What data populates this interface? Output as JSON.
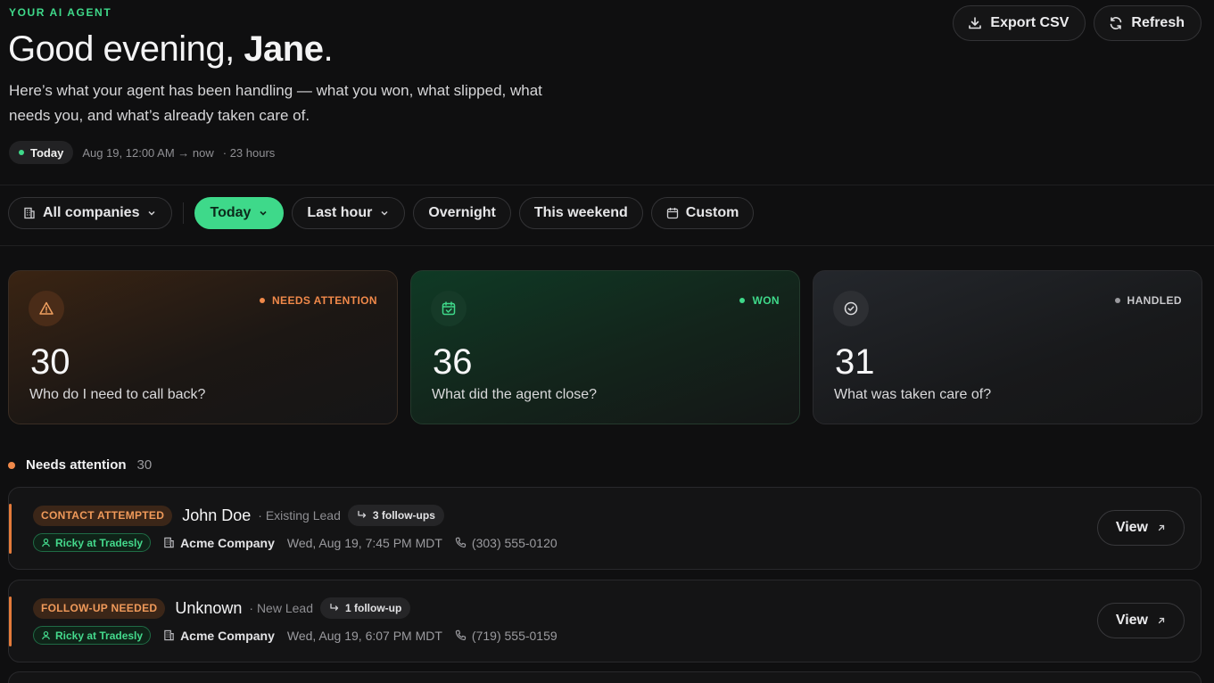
{
  "header": {
    "eyebrow": "YOUR AI AGENT",
    "greeting_prefix": "Good evening, ",
    "greeting_name": "Jane",
    "greeting_suffix": ".",
    "subtitle": "Here’s what your agent has been handling — what you won, what slipped, what needs you, and what’s already taken care of.",
    "period_label": "Today",
    "period_range": "Aug 19, 12:00 AM → now",
    "period_duration": "· 23 hours",
    "export_label": "Export CSV",
    "refresh_label": "Refresh"
  },
  "filters": {
    "company": "All companies",
    "items": [
      {
        "label": "Today",
        "active": true
      },
      {
        "label": "Last hour"
      },
      {
        "label": "Overnight"
      },
      {
        "label": "This weekend"
      },
      {
        "label": "Custom"
      }
    ]
  },
  "cards": [
    {
      "tag": "NEEDS ATTENTION",
      "count": "30",
      "question": "Who do I need to call back?",
      "color": "#f0894a"
    },
    {
      "tag": "WON",
      "count": "36",
      "question": "What did the agent close?",
      "color": "#3fd98a"
    },
    {
      "tag": "HANDLED",
      "count": "31",
      "question": "What was taken care of?",
      "color": "#b8b8bc"
    }
  ],
  "section": {
    "title": "Needs attention",
    "count": "30"
  },
  "rows": [
    {
      "status": "CONTACT ATTEMPTED",
      "name": "John Doe",
      "lead_type": "· Existing Lead",
      "followups": "3 follow-ups",
      "agent": "Ricky at Tradesly",
      "company": "Acme Company",
      "datetime": "Wed, Aug 19, 7:45 PM MDT",
      "phone": "(303) 555-0120",
      "view_label": "View"
    },
    {
      "status": "FOLLOW-UP NEEDED",
      "name": "Unknown",
      "lead_type": "· New Lead",
      "followups": "1 follow-up",
      "agent": "Ricky at Tradesly",
      "company": "Acme Company",
      "datetime": "Wed, Aug 19, 6:07 PM MDT",
      "phone": "(719) 555-0159",
      "view_label": "View"
    }
  ],
  "colors": {
    "accent": "#3fd98a",
    "attention": "#f0894a",
    "background": "#0f0f10"
  }
}
